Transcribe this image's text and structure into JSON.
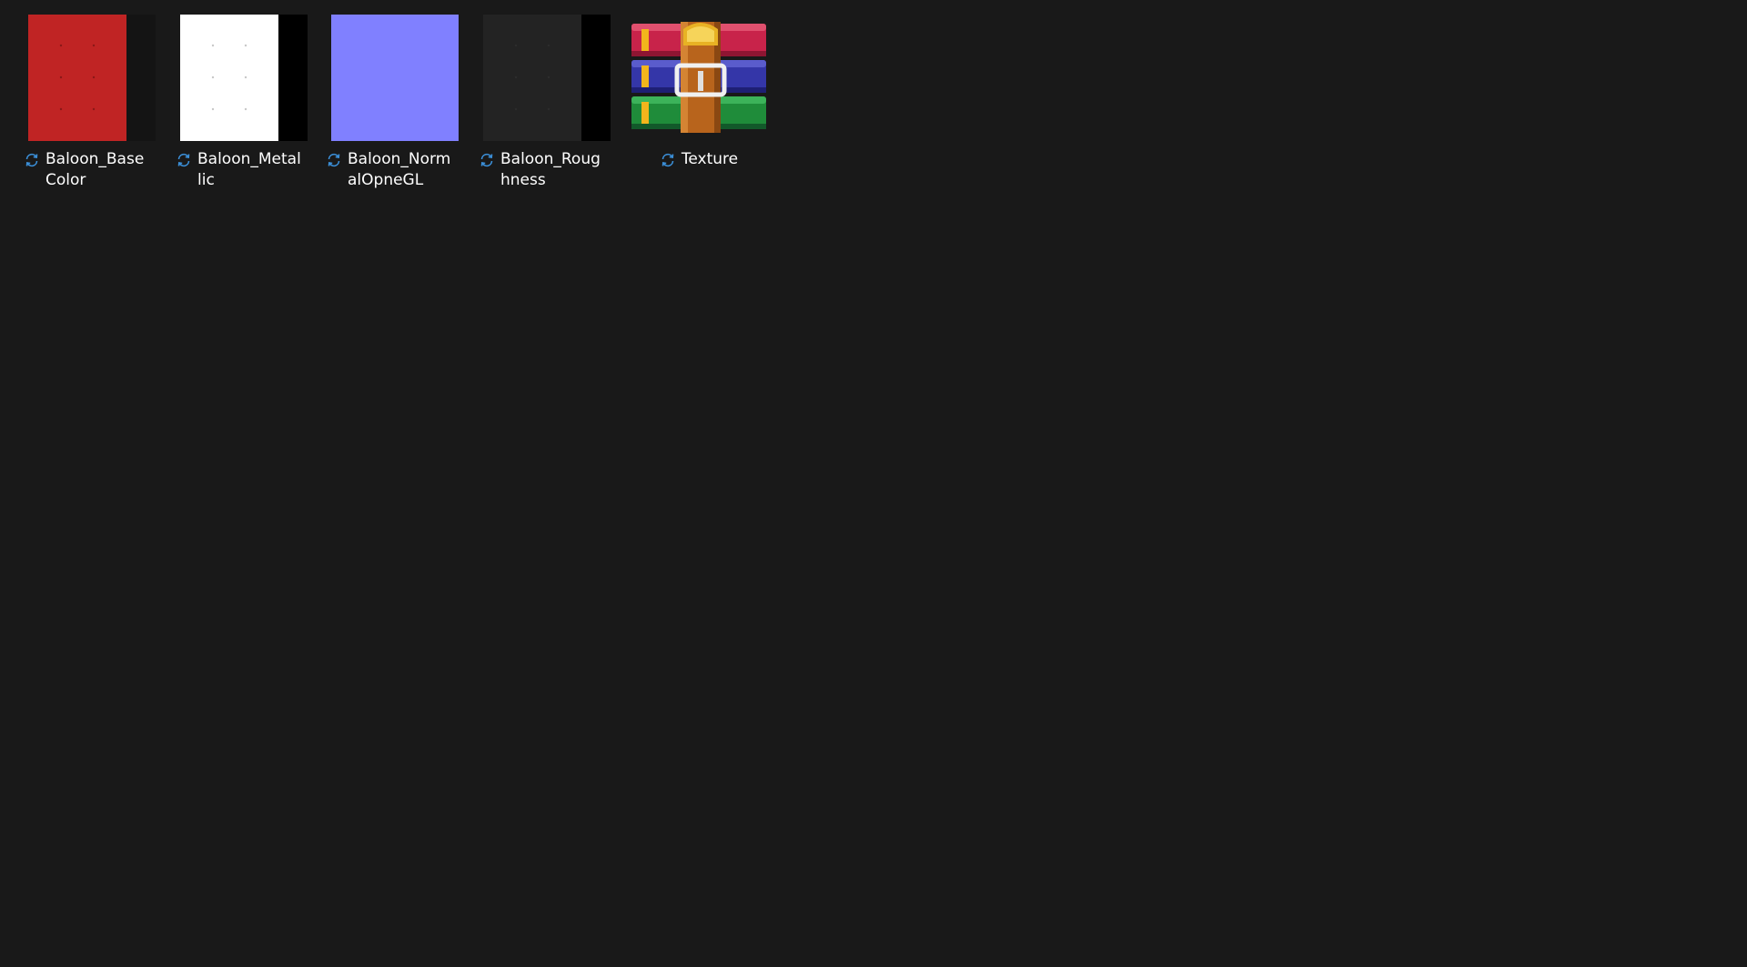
{
  "files": [
    {
      "name": "Baloon_BaseColor",
      "type": "texture-image",
      "status": "sync-pending",
      "thumbnail_color": "#c02424"
    },
    {
      "name": "Baloon_Metallic",
      "type": "texture-image",
      "status": "sync-pending",
      "thumbnail_color": "#ffffff"
    },
    {
      "name": "Baloon_NormalOpneGL",
      "type": "texture-image",
      "status": "sync-pending",
      "thumbnail_color": "#8080ff"
    },
    {
      "name": "Baloon_Roughness",
      "type": "texture-image",
      "status": "sync-pending",
      "thumbnail_color": "#232323"
    },
    {
      "name": "Texture",
      "type": "winrar-archive",
      "status": "sync-pending",
      "icon": "winrar-archive-icon"
    }
  ],
  "colors": {
    "background": "#191919",
    "text": "#ffffff",
    "sync_icon": "#3b8fd8"
  }
}
